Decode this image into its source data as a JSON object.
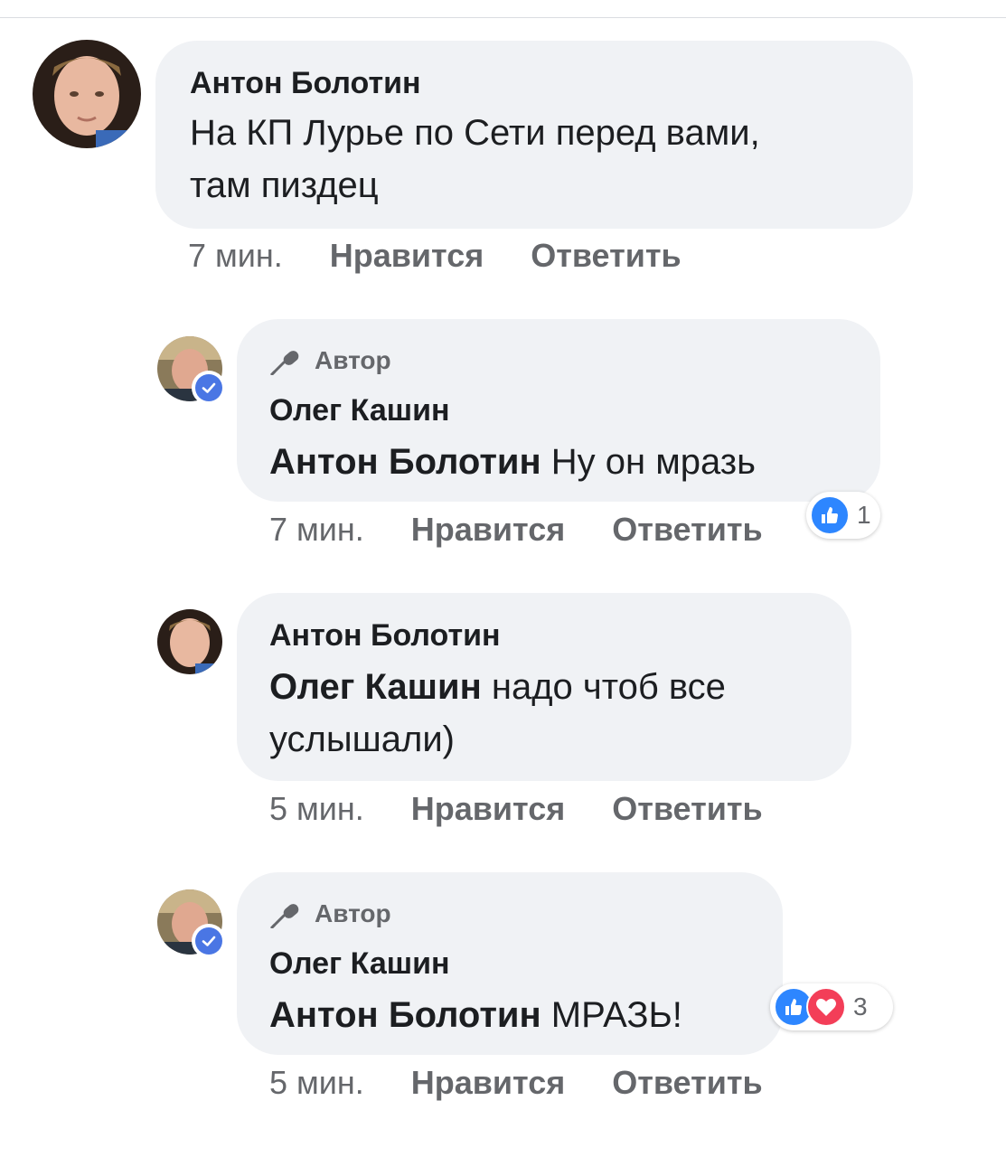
{
  "comments": [
    {
      "name": "Антон Болотин",
      "mention": "",
      "text_line1": "На КП Лурье по Сети перед вами,",
      "text_line2": "там пиздец",
      "time": "7 мин.",
      "like": "Нравится",
      "reply": "Ответить"
    },
    {
      "author_badge": "Автор",
      "name": "Олег Кашин",
      "mention": "Антон Болотин",
      "text": "Ну он мразь",
      "time": "7 мин.",
      "like": "Нравится",
      "reply": "Ответить",
      "reaction_count": "1"
    },
    {
      "name": "Антон Болотин",
      "mention": "Олег Кашин",
      "text_line1": "надо чтоб все",
      "text_line2": "услышали)",
      "time": "5 мин.",
      "like": "Нравится",
      "reply": "Ответить"
    },
    {
      "author_badge": "Автор",
      "name": "Олег Кашин",
      "mention": "Антон Болотин",
      "text": "МРАЗЬ!",
      "time": "5 мин.",
      "like": "Нравится",
      "reply": "Ответить",
      "reaction_count": "3"
    }
  ],
  "colors": {
    "bubble": "#f0f2f5",
    "meta_text": "#65676b",
    "like_reaction": "#2d86ff",
    "love_reaction": "#f33e58",
    "verified": "#4a76e4"
  },
  "icons": [
    "microphone-icon",
    "verified-check-icon",
    "thumbs-up-icon",
    "heart-icon"
  ]
}
